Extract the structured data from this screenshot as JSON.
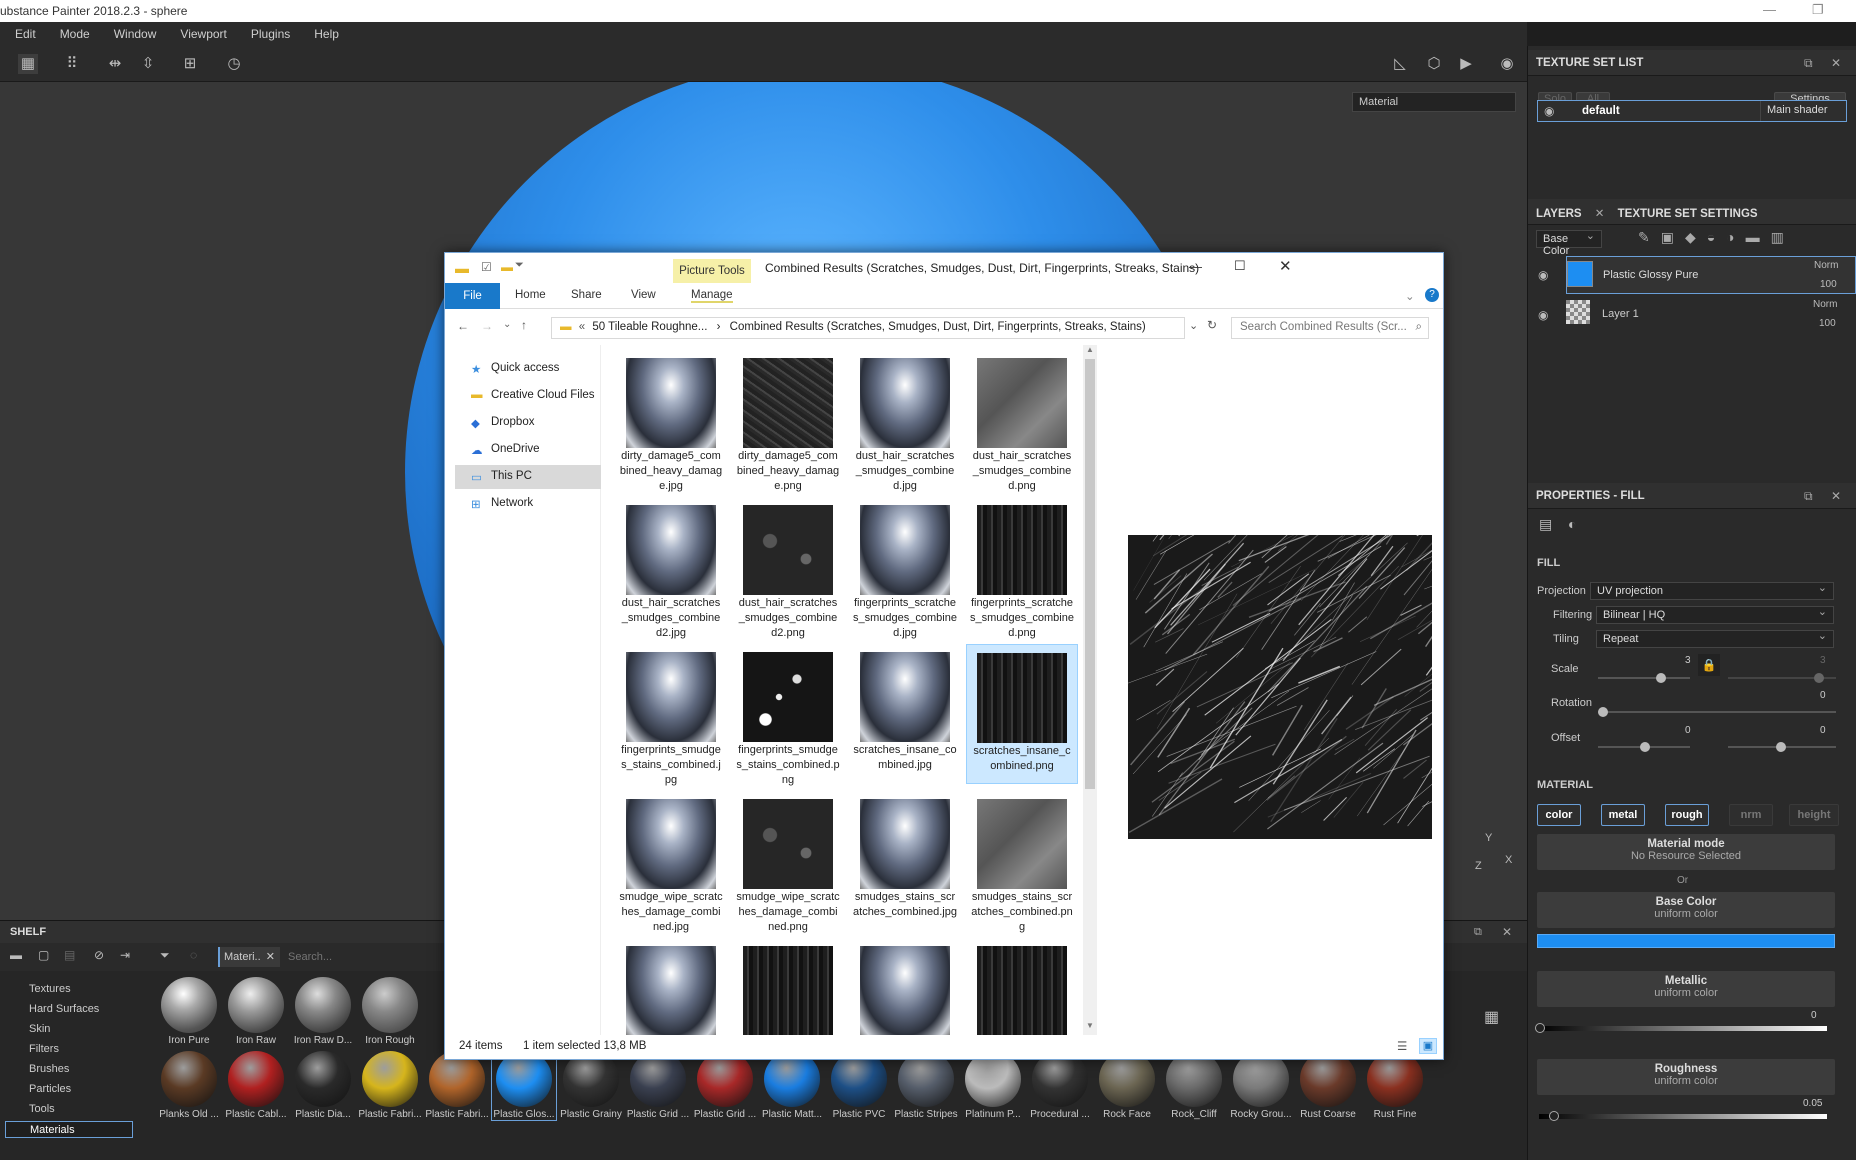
{
  "window": {
    "title": "ubstance Painter 2018.2.3 - sphere"
  },
  "menu": [
    "Edit",
    "Mode",
    "Window",
    "Viewport",
    "Plugins",
    "Help"
  ],
  "viewport": {
    "channel_select": "Material"
  },
  "texture_set_list": {
    "title": "TEXTURE SET LIST",
    "solo": "Solo",
    "all": "All",
    "settings": "Settings",
    "set_name": "default",
    "shader": "Main shader"
  },
  "layers": {
    "tab1": "LAYERS",
    "tab2": "TEXTURE SET SETTINGS",
    "channel": "Base Color",
    "items": [
      {
        "name": "Plastic Glossy Pure",
        "blend": "Norm",
        "opacity": "100"
      },
      {
        "name": "Layer 1",
        "blend": "Norm",
        "opacity": "100"
      }
    ]
  },
  "properties": {
    "title": "PROPERTIES - FILL",
    "fill_label": "FILL",
    "projection_label": "Projection",
    "projection": "UV projection",
    "filtering_label": "Filtering",
    "filtering": "Bilinear | HQ",
    "tiling_label": "Tiling",
    "tiling": "Repeat",
    "scale_label": "Scale",
    "scale_value": "3",
    "scale_value2": "3",
    "rotation_label": "Rotation",
    "rotation_value": "0",
    "offset_label": "Offset",
    "offset_x": "0",
    "offset_y": "0",
    "material_label": "MATERIAL",
    "channels": [
      "color",
      "metal",
      "rough",
      "nrm",
      "height"
    ],
    "material_mode": "Material mode",
    "no_resource": "No Resource Selected",
    "or": "Or",
    "base_color": "Base Color",
    "base_color_sub": "uniform color",
    "metallic": "Metallic",
    "metallic_sub": "uniform color",
    "metallic_value": "0",
    "roughness": "Roughness",
    "roughness_sub": "uniform color",
    "roughness_value": "0.05",
    "base_color_hex": "#1d8ef2"
  },
  "shelf": {
    "title": "SHELF",
    "filter_tag": "Materi..",
    "search_placeholder": "Search...",
    "categories": [
      "Textures",
      "Hard Surfaces",
      "Skin",
      "Filters",
      "Brushes",
      "Particles",
      "Tools",
      "Materials"
    ],
    "row1": [
      "Iron Pure",
      "Iron Raw",
      "Iron Raw D...",
      "Iron Rough"
    ],
    "row2": [
      "Planks Old ...",
      "Plastic Cabl...",
      "Plastic Dia...",
      "Plastic Fabri...",
      "Plastic Fabri...",
      "Plastic Glos...",
      "Plastic Grainy",
      "Plastic Grid ...",
      "Plastic Grid ...",
      "Plastic Matt...",
      "Plastic PVC",
      "Plastic Stripes",
      "Platinum P...",
      "Procedural ...",
      "Rock Face",
      "Rock_Cliff",
      "Rocky Grou...",
      "Rust Coarse",
      "Rust Fine"
    ]
  },
  "explorer": {
    "title": "Combined Results (Scratches, Smudges, Dust, Dirt, Fingerprints, Streaks, Stains)",
    "picture_tools": "Picture Tools",
    "tabs": [
      "File",
      "Home",
      "Share",
      "View",
      "Manage"
    ],
    "address_root": "50 Tileable Roughne...",
    "address_current": "Combined Results (Scratches, Smudges, Dust, Dirt, Fingerprints, Streaks, Stains)",
    "search_placeholder": "Search Combined Results (Scr...",
    "nav": [
      "Quick access",
      "Creative Cloud Files",
      "Dropbox",
      "OneDrive",
      "This PC",
      "Network"
    ],
    "files": [
      "dirty_damage5_combined_heavy_damage.jpg",
      "dirty_damage5_combined_heavy_damage.png",
      "dust_hair_scratches_smudges_combined.jpg",
      "dust_hair_scratches_smudges_combined.png",
      "dust_hair_scratches_smudges_combined2.jpg",
      "dust_hair_scratches_smudges_combined2.png",
      "fingerprints_scratches_smudges_combined.jpg",
      "fingerprints_scratches_smudges_combined.png",
      "fingerprints_smudges_stains_combined.jpg",
      "fingerprints_smudges_stains_combined.png",
      "scratches_insane_combined.jpg",
      "scratches_insane_combined.png",
      "smudge_wipe_scratches_damage_combined.jpg",
      "smudge_wipe_scratches_damage_combined.png",
      "smudges_stains_scratches_combined.jpg",
      "smudges_stains_scratches_combined.png"
    ],
    "status_count": "24 items",
    "status_selected": "1 item selected  13,8 MB"
  }
}
